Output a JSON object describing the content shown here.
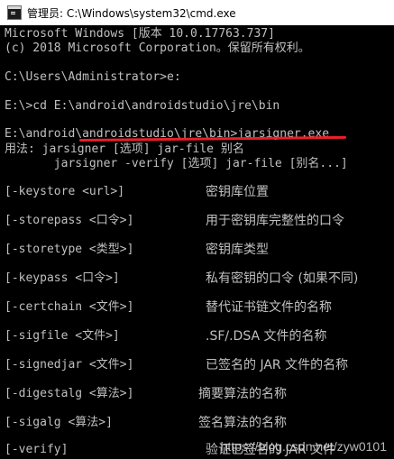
{
  "window": {
    "title": "管理员: C:\\Windows\\system32\\cmd.exe"
  },
  "console": {
    "lines": [
      "Microsoft Windows [版本 10.0.17763.737]",
      "(c) 2018 Microsoft Corporation。保留所有权利。",
      "",
      "C:\\Users\\Administrator>e:",
      "",
      "E:\\>cd E:\\android\\androidstudio\\jre\\bin",
      "",
      "E:\\android\\androidstudio\\jre\\bin>jarsigner.exe",
      "用法: jarsigner [选项] jar-file 别名",
      "       jarsigner -verify [选项] jar-file [别名...]"
    ],
    "options": [
      {
        "flag": "[-keystore <url>]",
        "desc": "密钥库位置"
      },
      {
        "flag": "[-storepass <口令>]",
        "desc": "用于密钥库完整性的口令"
      },
      {
        "flag": "[-storetype <类型>]",
        "desc": "密钥库类型"
      },
      {
        "flag": "[-keypass <口令>]",
        "desc": "私有密钥的口令 (如果不同)"
      },
      {
        "flag": "[-certchain <文件>]",
        "desc": "替代证书链文件的名称"
      },
      {
        "flag": "[-sigfile <文件>]",
        "desc": ".SF/.DSA 文件的名称"
      },
      {
        "flag": "[-signedjar <文件>]",
        "desc": "已签名的 JAR 文件的名称"
      },
      {
        "flag": "[-digestalg <算法>]",
        "desc": "摘要算法的名称"
      },
      {
        "flag": "[-sigalg <算法>]",
        "desc": "签名算法的名称"
      },
      {
        "flag": "[-verify]",
        "desc": "验证已签名的 JAR 文件"
      }
    ]
  },
  "watermark": "https://blog.csdn.net/zyw0101",
  "colors": {
    "background": "#000000",
    "text": "#c0c0c0",
    "annotation": "#e8202a"
  }
}
